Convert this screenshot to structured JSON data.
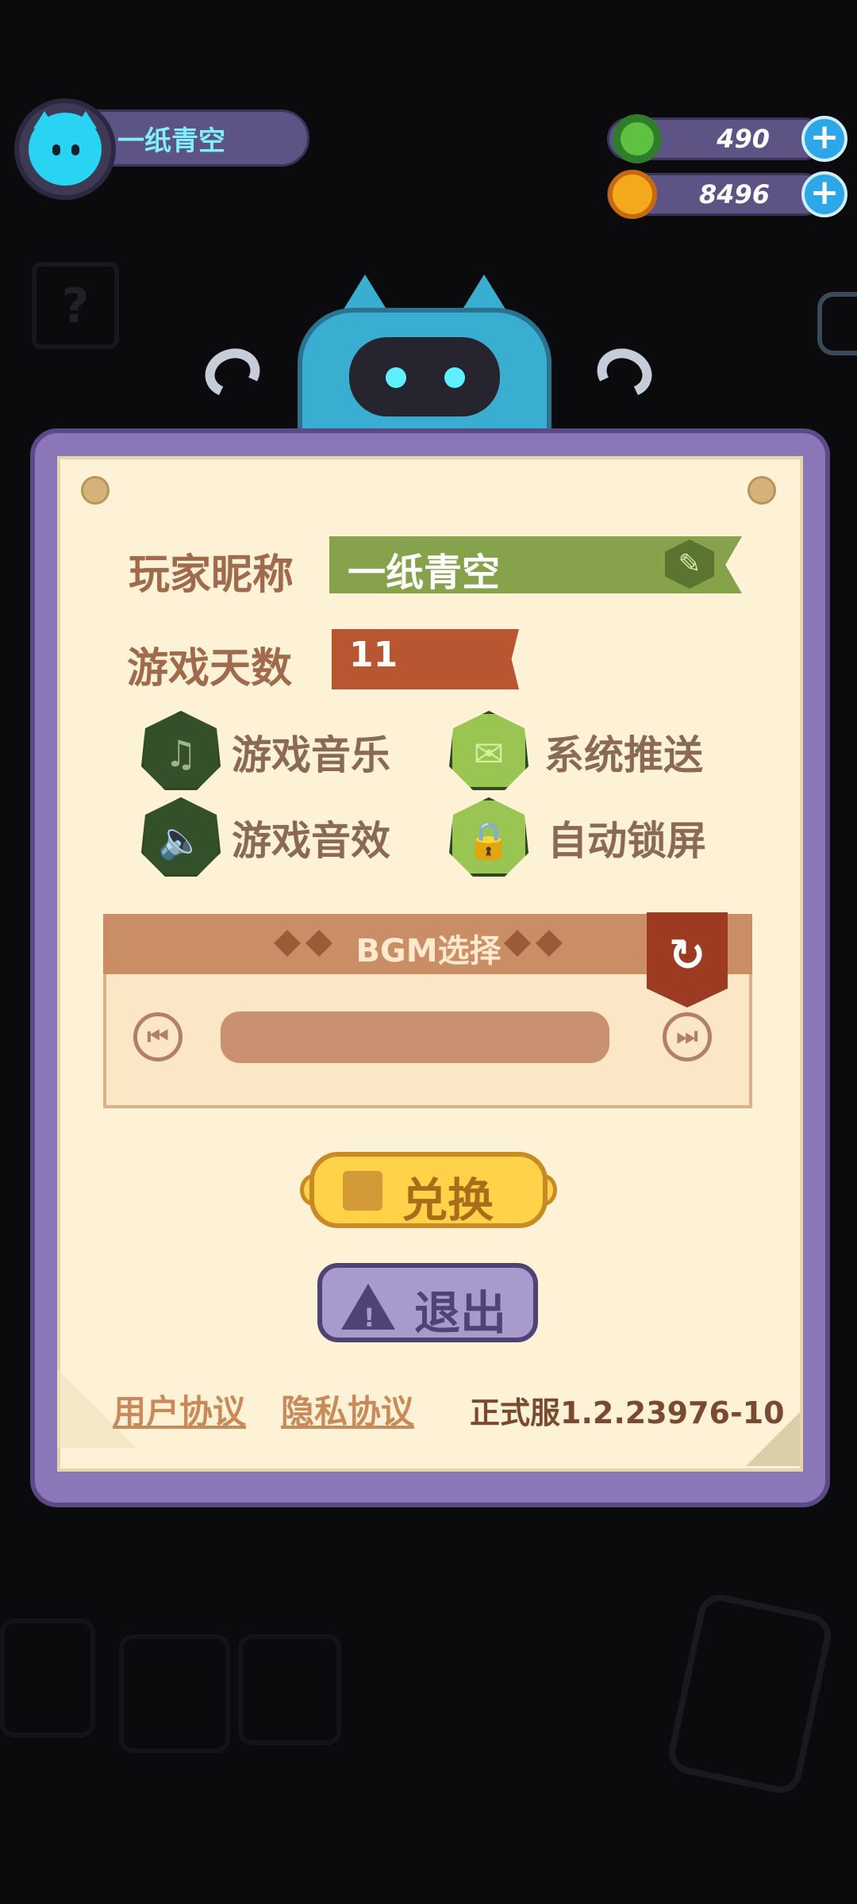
{
  "profile": {
    "name": "一纸青空"
  },
  "currency": [
    {
      "value": "490",
      "icon": "green-donut-icon",
      "color": "#5fc141"
    },
    {
      "value": "8496",
      "icon": "planet-coin-icon",
      "color": "#f4a81c"
    }
  ],
  "settings": {
    "nickname_label": "玩家昵称",
    "nickname_value": "一纸青空",
    "days_label": "游戏天数",
    "days_value": "11",
    "toggles": [
      {
        "label": "游戏音乐",
        "icon": "music-note-icon",
        "on": false
      },
      {
        "label": "系统推送",
        "icon": "envelope-icon",
        "on": true
      },
      {
        "label": "游戏音效",
        "icon": "speaker-icon",
        "on": false
      },
      {
        "label": "自动锁屏",
        "icon": "lock-icon",
        "on": true
      }
    ]
  },
  "bgm": {
    "title": "BGM选择"
  },
  "buttons": {
    "exchange": "兑换",
    "exit": "退出"
  },
  "footer": {
    "user_agreement": "用户协议",
    "privacy_agreement": "隐私协议",
    "version": "正式服1.2.23976-10"
  }
}
